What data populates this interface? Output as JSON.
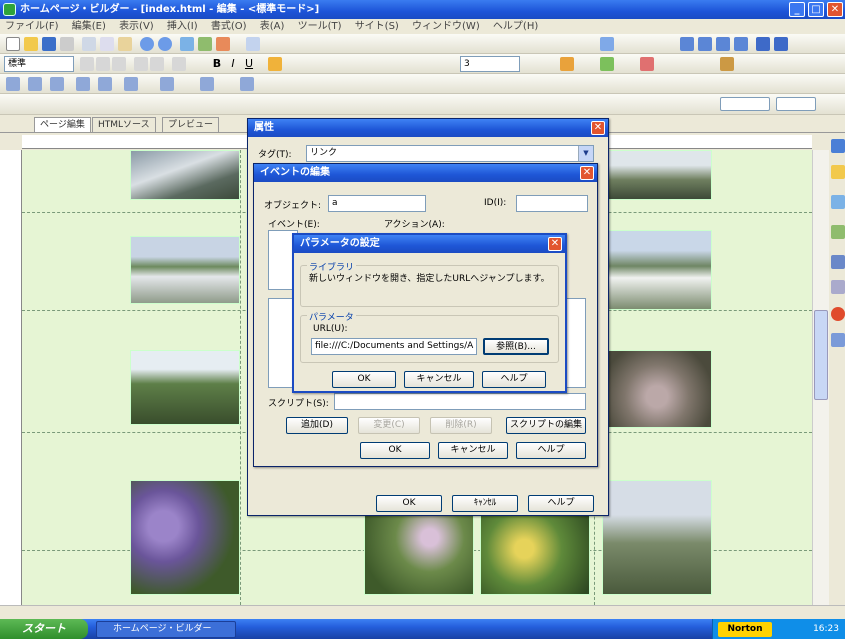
{
  "app": {
    "title": "ホームページ・ビルダー - [index.html - 編集 - <標準モード>]",
    "menu": [
      "ファイル(F)",
      "編集(E)",
      "表示(V)",
      "挿入(I)",
      "書式(O)",
      "表(A)",
      "ツール(T)",
      "サイト(S)",
      "ウィンドウ(W)",
      "ヘルプ(H)"
    ],
    "font_combo": "標準",
    "size_combo": "3"
  },
  "tabs": [
    "ページ編集",
    "HTMLソース",
    "プレビュー"
  ],
  "properties_dialog": {
    "title": "属性",
    "type_label": "タグ(T):",
    "type_value": "リンク",
    "ok": "OK",
    "cancel": "ｷｬﾝｾﾙ",
    "help": "ヘルプ"
  },
  "event_dialog": {
    "title": "イベントの編集",
    "object_label": "オブジェクト:",
    "object_value": "a",
    "id_label": "ID(I):",
    "event_label": "イベント(E):",
    "action_label": "アクション(A):",
    "script_label": "スクリプト(S):",
    "add_button": "追加(D)",
    "change_button": "変更(C)",
    "delete_button": "削除(R)",
    "script_edit_button": "スクリプトの編集",
    "ok": "OK",
    "cancel": "キャンセル",
    "help": "ヘルプ"
  },
  "param_dialog": {
    "title": "パラメータの設定",
    "library_group": "ライブラリ",
    "library_desc": "新しいウィンドウを開き、指定したURLへジャンプします。",
    "param_group": "パラメータ",
    "url_label": "URL(U):",
    "url_value": "file:///C:/Documents and Settings/A",
    "browse_button": "参照(B)...",
    "ok": "OK",
    "cancel": "キャンセル",
    "help": "ヘルプ"
  },
  "taskbar": {
    "start": "スタート",
    "app_button": "ホームページ・ビルダー",
    "norton": "Norton",
    "clock": "16:23"
  }
}
